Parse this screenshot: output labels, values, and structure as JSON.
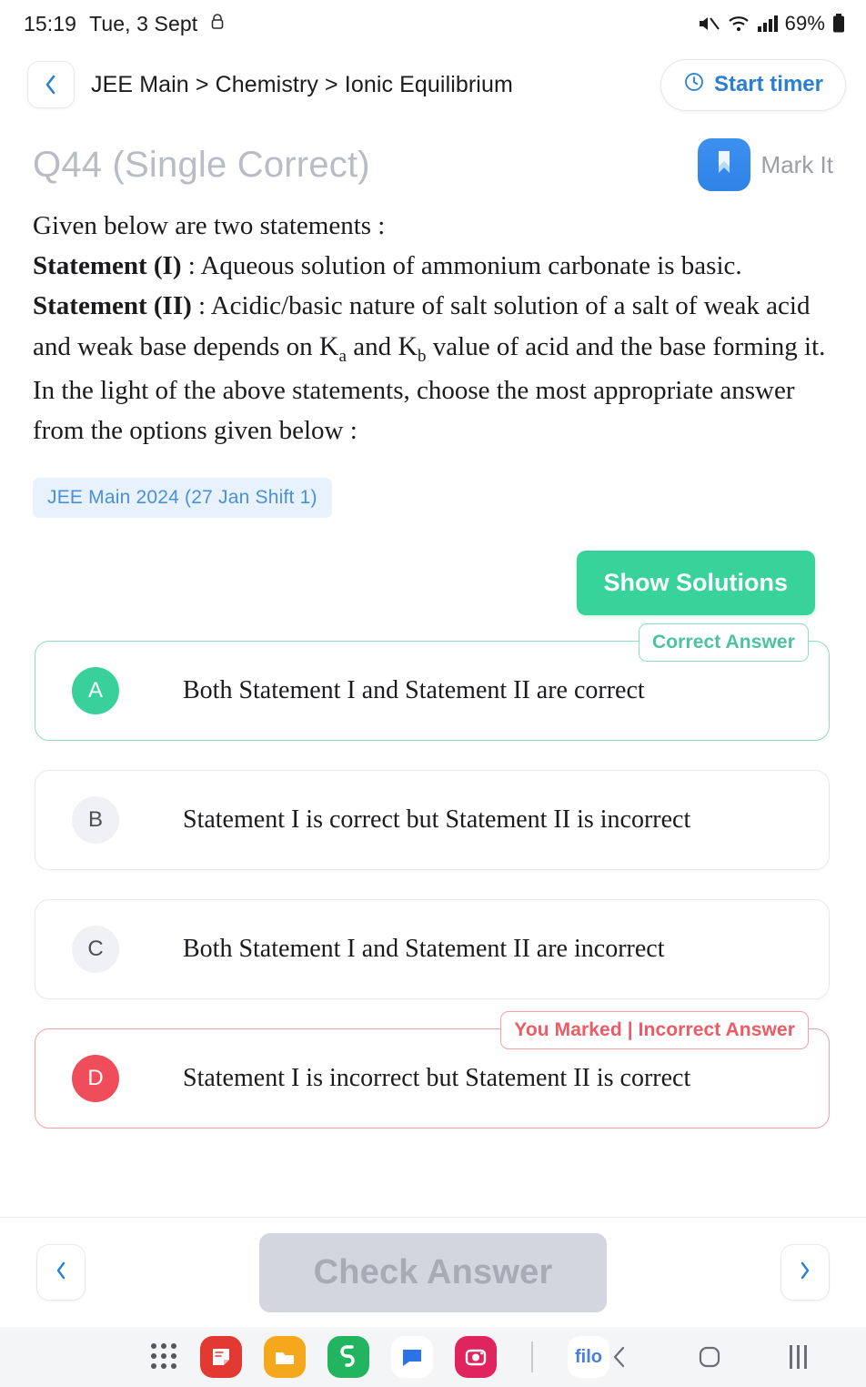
{
  "status_bar": {
    "time": "15:19",
    "date": "Tue, 3 Sept",
    "lock_icon": "lock-icon",
    "mute_icon": "mute-icon",
    "wifi_icon": "wifi-icon",
    "signal_icon": "signal-bars-icon",
    "battery_text": "69%",
    "battery_icon": "battery-icon"
  },
  "header": {
    "back_icon": "chevron-left-icon",
    "breadcrumb": "JEE Main > Chemistry > Ionic Equilibrium",
    "timer_label": "Start timer",
    "timer_icon": "clock-icon"
  },
  "question": {
    "title": "Q44 (Single Correct)",
    "mark_label": "Mark It",
    "mark_icon": "bookmark-icon",
    "line1": "Given below are two statements :",
    "statement1_label": "Statement (I)",
    "statement1_text": " : Aqueous solution of ammonium carbonate is basic.",
    "statement2_label": "Statement (II)",
    "statement2_text_a": " : Acidic/basic nature of salt solution of a salt of weak acid and weak base depends on ",
    "k_a": "K",
    "k_a_sub": "a",
    "k_mid": " and ",
    "k_b": "K",
    "k_b_sub": "b",
    "statement2_text_b": " value of acid and the base forming it.",
    "line_closing": "In the light of the above statements, choose the most appropriate answer from the options given below :",
    "tag": "JEE Main 2024 (27 Jan Shift 1)"
  },
  "actions": {
    "show_solutions": "Show Solutions",
    "check_answer": "Check Answer",
    "prev_icon": "chevron-left-icon",
    "next_icon": "chevron-right-icon"
  },
  "options": [
    {
      "letter": "A",
      "text": "Both Statement I and Statement II are correct",
      "state": "correct",
      "chip": "Correct Answer"
    },
    {
      "letter": "B",
      "text": "Statement I is correct but Statement II is incorrect",
      "state": "neutral",
      "chip": ""
    },
    {
      "letter": "C",
      "text": "Both Statement I and Statement II are incorrect",
      "state": "neutral",
      "chip": ""
    },
    {
      "letter": "D",
      "text": "Statement I is incorrect but Statement II is correct",
      "state": "wrong",
      "chip": "You Marked | Incorrect Answer"
    }
  ],
  "taskbar": {
    "apps_icon": "app-grid-icon",
    "app_icons": [
      "notes-icon",
      "files-icon",
      "phone-icon",
      "messages-icon",
      "instagram-icon"
    ],
    "filo_label": "filo",
    "nav_back_icon": "nav-back-icon",
    "nav_home_icon": "nav-home-icon",
    "nav_recents_icon": "nav-recents-icon"
  },
  "colors": {
    "accent_blue": "#2a7fd4",
    "correct_green": "#3ad09c",
    "incorrect_red": "#ef4d5a",
    "button_green": "#37d39b",
    "tag_bg": "#e8f2fd",
    "disabled_gray": "#d3d6de"
  }
}
